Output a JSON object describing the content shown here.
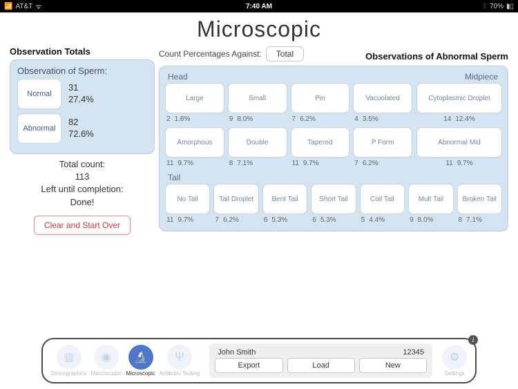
{
  "status": {
    "carrier": "AT&T",
    "time": "7:40 AM",
    "battery": "70%"
  },
  "title": "Microscopic",
  "left": {
    "heading": "Observation Totals",
    "panel_heading": "Observation of Sperm:",
    "normal": {
      "label": "Normal",
      "count": "31",
      "pct": "27.4%"
    },
    "abnormal": {
      "label": "Abnormal",
      "count": "82",
      "pct": "72.6%"
    },
    "total_label": "Total count:",
    "total_value": "113",
    "left_label": "Left until completion:",
    "left_value": "Done!",
    "clear_label": "Clear and Start Over"
  },
  "against": {
    "label": "Count Percentages Against:",
    "button": "Total"
  },
  "right_heading": "Observations of Abnormal Sperm",
  "groups": {
    "head_label": "Head",
    "mid_label": "Midpiece",
    "tail_label": "Tail"
  },
  "head_row1": [
    {
      "name": "Large",
      "n": "2",
      "p": "1.8%"
    },
    {
      "name": "Small",
      "n": "9",
      "p": "8.0%"
    },
    {
      "name": "Pin",
      "n": "7",
      "p": "6.2%"
    },
    {
      "name": "Vacuolated",
      "n": "4",
      "p": "3.5%"
    }
  ],
  "mid_row1": {
    "name": "Cytoplasmic Droplet",
    "n": "14",
    "p": "12.4%"
  },
  "head_row2": [
    {
      "name": "Amorphous",
      "n": "11",
      "p": "9.7%"
    },
    {
      "name": "Double",
      "n": "8",
      "p": "7.1%"
    },
    {
      "name": "Tapered",
      "n": "11",
      "p": "9.7%"
    },
    {
      "name": "P Form",
      "n": "7",
      "p": "6.2%"
    }
  ],
  "mid_row2": {
    "name": "Abnormal Mid",
    "n": "11",
    "p": "9.7%"
  },
  "tail_row": [
    {
      "name": "No Tail",
      "n": "11",
      "p": "9.7%"
    },
    {
      "name": "Tail Droplet",
      "n": "7",
      "p": "6.2%"
    },
    {
      "name": "Bent Tail",
      "n": "6",
      "p": "5.3%"
    },
    {
      "name": "Short Tail",
      "n": "6",
      "p": "5.3%"
    },
    {
      "name": "Coil Tail",
      "n": "5",
      "p": "4.4%"
    },
    {
      "name": "Mult Tail",
      "n": "9",
      "p": "8.0%"
    },
    {
      "name": "Broken Tail",
      "n": "8",
      "p": "7.1%"
    }
  ],
  "toolbar": {
    "tabs": [
      {
        "label": "Demographics"
      },
      {
        "label": "Macroscopic"
      },
      {
        "label": "Microscopic"
      },
      {
        "label": "Antibody Testing"
      }
    ],
    "patient_name": "John Smith",
    "patient_id": "12345",
    "export": "Export",
    "load": "Load",
    "new": "New",
    "settings": "Settings"
  }
}
